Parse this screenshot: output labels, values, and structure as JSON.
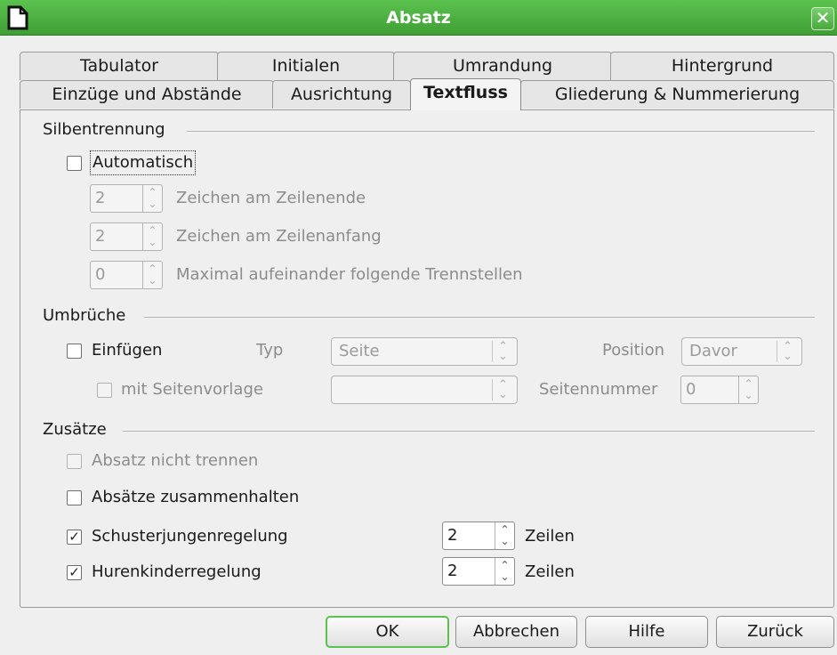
{
  "window": {
    "title": "Absatz",
    "close_symbol": "✕"
  },
  "tabs": {
    "row1": [
      "Tabulator",
      "Initialen",
      "Umrandung",
      "Hintergrund"
    ],
    "row2": [
      "Einzüge und Abstände",
      "Ausrichtung",
      "Textfluss",
      "Gliederung & Nummerierung"
    ],
    "active": "Textfluss"
  },
  "silbentrennung": {
    "title": "Silbentrennung",
    "automatisch": {
      "label": "Automatisch",
      "checked": false
    },
    "rows": [
      {
        "value": "2",
        "label": "Zeichen am Zeilenende"
      },
      {
        "value": "2",
        "label": "Zeichen am Zeilenanfang"
      },
      {
        "value": "0",
        "label": "Maximal aufeinander folgende Trennstellen"
      }
    ]
  },
  "umbrueche": {
    "title": "Umbrüche",
    "einfuegen": {
      "label": "Einfügen",
      "checked": false
    },
    "typ_label": "Typ",
    "typ_value": "Seite",
    "position_label": "Position",
    "position_value": "Davor",
    "mit_seitenvorlage": {
      "label": "mit Seitenvorlage",
      "checked": false
    },
    "seitenvorlage_value": "",
    "seitennummer_label": "Seitennummer",
    "seitennummer_value": "0"
  },
  "zusaetze": {
    "title": "Zusätze",
    "absatz_nicht_trennen": {
      "label": "Absatz nicht trennen",
      "checked": false
    },
    "absaetze_zusammenhalten": {
      "label": "Absätze zusammenhalten",
      "checked": false
    },
    "schusterjungen": {
      "label": "Schusterjungenregelung",
      "checked": true,
      "value": "2",
      "unit": "Zeilen"
    },
    "hurenkinder": {
      "label": "Hurenkinderregelung",
      "checked": true,
      "value": "2",
      "unit": "Zeilen"
    }
  },
  "buttons": {
    "ok": "OK",
    "abbrechen": "Abbrechen",
    "hilfe": "Hilfe",
    "zurueck": "Zurück"
  },
  "glyphs": {
    "check": "✓",
    "spin_up": "⌃",
    "spin_down": "⌄"
  },
  "colors": {
    "titlebar": "#4caf3e",
    "default_button_border": "#5cc24f"
  }
}
